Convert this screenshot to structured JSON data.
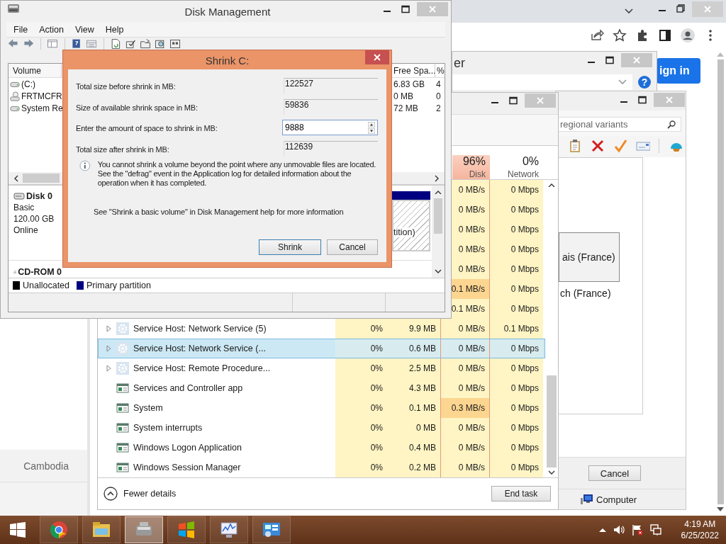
{
  "browser": {
    "sign_in": "ign in",
    "side_label": "Cambodia"
  },
  "back_window": {
    "title": "er",
    "help": "?"
  },
  "language_window": {
    "search_placeholder": "regional variants",
    "items": [
      {
        "label": "ais (France)",
        "selected": true
      },
      {
        "label": "ch (France)",
        "selected": false
      }
    ],
    "cancel": "Cancel",
    "status": "Computer"
  },
  "task_manager": {
    "columns": [
      {
        "percent": "96%",
        "label": "Disk",
        "busy": true
      },
      {
        "percent": "0%",
        "label": "Network",
        "busy": false
      }
    ],
    "rows": [
      {
        "disk": "0 MB/s",
        "network": "0 Mbps",
        "disk_busy": false,
        "selected": false
      },
      {
        "disk": "0 MB/s",
        "network": "0 Mbps",
        "disk_busy": false,
        "selected": false
      },
      {
        "disk": "0 MB/s",
        "network": "0 Mbps",
        "disk_busy": false,
        "selected": false
      },
      {
        "disk": "0 MB/s",
        "network": "0 Mbps",
        "disk_busy": false,
        "selected": false
      },
      {
        "disk": "0 MB/s",
        "network": "0 Mbps",
        "disk_busy": false,
        "selected": false
      },
      {
        "disk": "0.1 MB/s",
        "network": "0 Mbps",
        "disk_busy": true,
        "selected": false
      },
      {
        "disk": "0.1 MB/s",
        "network": "0 Mbps",
        "disk_busy": false,
        "selected": false
      },
      {
        "name": "Service Host: Network Service (5)",
        "kind": "service",
        "expandable": true,
        "cpu": "0%",
        "memory": "9.9 MB",
        "disk": "0 MB/s",
        "network": "0.1 Mbps",
        "disk_busy": false,
        "selected": false
      },
      {
        "name": "Service Host: Network Service (...",
        "kind": "service",
        "expandable": true,
        "cpu": "0%",
        "memory": "0.6 MB",
        "disk": "0 MB/s",
        "network": "0 Mbps",
        "disk_busy": false,
        "selected": true
      },
      {
        "name": "Service Host: Remote Procedure...",
        "kind": "service",
        "expandable": true,
        "cpu": "0%",
        "memory": "2.5 MB",
        "disk": "0 MB/s",
        "network": "0 Mbps",
        "disk_busy": false,
        "selected": false
      },
      {
        "name": "Services and Controller app",
        "kind": "app",
        "expandable": false,
        "cpu": "0%",
        "memory": "4.3 MB",
        "disk": "0 MB/s",
        "network": "0 Mbps",
        "disk_busy": false,
        "selected": false
      },
      {
        "name": "System",
        "kind": "app",
        "expandable": false,
        "cpu": "0%",
        "memory": "0.1 MB",
        "disk": "0.3 MB/s",
        "network": "0 Mbps",
        "disk_busy": true,
        "selected": false
      },
      {
        "name": "System interrupts",
        "kind": "app",
        "expandable": false,
        "cpu": "0%",
        "memory": "0 MB",
        "disk": "0 MB/s",
        "network": "0 Mbps",
        "disk_busy": false,
        "selected": false
      },
      {
        "name": "Windows Logon Application",
        "kind": "app",
        "expandable": false,
        "cpu": "0%",
        "memory": "0.4 MB",
        "disk": "0 MB/s",
        "network": "0 Mbps",
        "disk_busy": false,
        "selected": false
      },
      {
        "name": "Windows Session Manager",
        "kind": "app",
        "expandable": false,
        "cpu": "0%",
        "memory": "0.2 MB",
        "disk": "0 MB/s",
        "network": "0 Mbps",
        "disk_busy": false,
        "selected": false
      }
    ],
    "fewer_details": "Fewer details",
    "end_task": "End task"
  },
  "disk_management": {
    "title": "Disk Management",
    "menu": [
      "File",
      "Action",
      "View",
      "Help"
    ],
    "columns": [
      "Volume",
      "Free Spa...",
      "%"
    ],
    "volumes": [
      {
        "name": "(C:)",
        "kind": "drive",
        "free": "6.83 GB",
        "percent": "4"
      },
      {
        "name": "FRTMCFR",
        "kind": "cd",
        "free": "0 MB",
        "percent": "0"
      },
      {
        "name": "System Re",
        "kind": "drive",
        "free": "72 MB",
        "percent": "2"
      }
    ],
    "disks": [
      {
        "name": "Disk 0",
        "kind": "disk",
        "lines": [
          "Basic",
          "120.00 GB",
          "Online"
        ],
        "partition": "tition)"
      },
      {
        "name": "CD-ROM 0",
        "kind": "cd"
      }
    ],
    "legend": [
      {
        "label": "Unallocated",
        "color": "#000000"
      },
      {
        "label": "Primary partition",
        "color": "#000080"
      }
    ]
  },
  "shrink_dialog": {
    "title": "Shrink C:",
    "fields": [
      {
        "label": "Total size before shrink in MB:",
        "value": "122527",
        "editable": false
      },
      {
        "label": "Size of available shrink space in MB:",
        "value": "59836",
        "editable": false
      },
      {
        "label": "Enter the amount of space to shrink in MB:",
        "value": "9888",
        "editable": true
      },
      {
        "label": "Total size after shrink in MB:",
        "value": "112639",
        "editable": false
      }
    ],
    "info": "You cannot shrink a volume beyond the point where any unmovable files are located. See the \"defrag\" event in the Application log for detailed information about the operation when it has completed.",
    "help_note": "See \"Shrink a basic volume\" in Disk Management help for more information",
    "buttons": [
      {
        "label": "Shrink",
        "default": true
      },
      {
        "label": "Cancel",
        "default": false
      }
    ]
  },
  "taskbar": {
    "apps": [
      {
        "kind": "chrome",
        "active": false
      },
      {
        "kind": "explorer",
        "active": false
      },
      {
        "kind": "drive",
        "active": true
      },
      {
        "kind": "windows",
        "active": false
      },
      {
        "kind": "monitor",
        "active": false
      },
      {
        "kind": "control",
        "active": false
      }
    ],
    "time": "4:19 AM",
    "date": "6/25/2022"
  }
}
